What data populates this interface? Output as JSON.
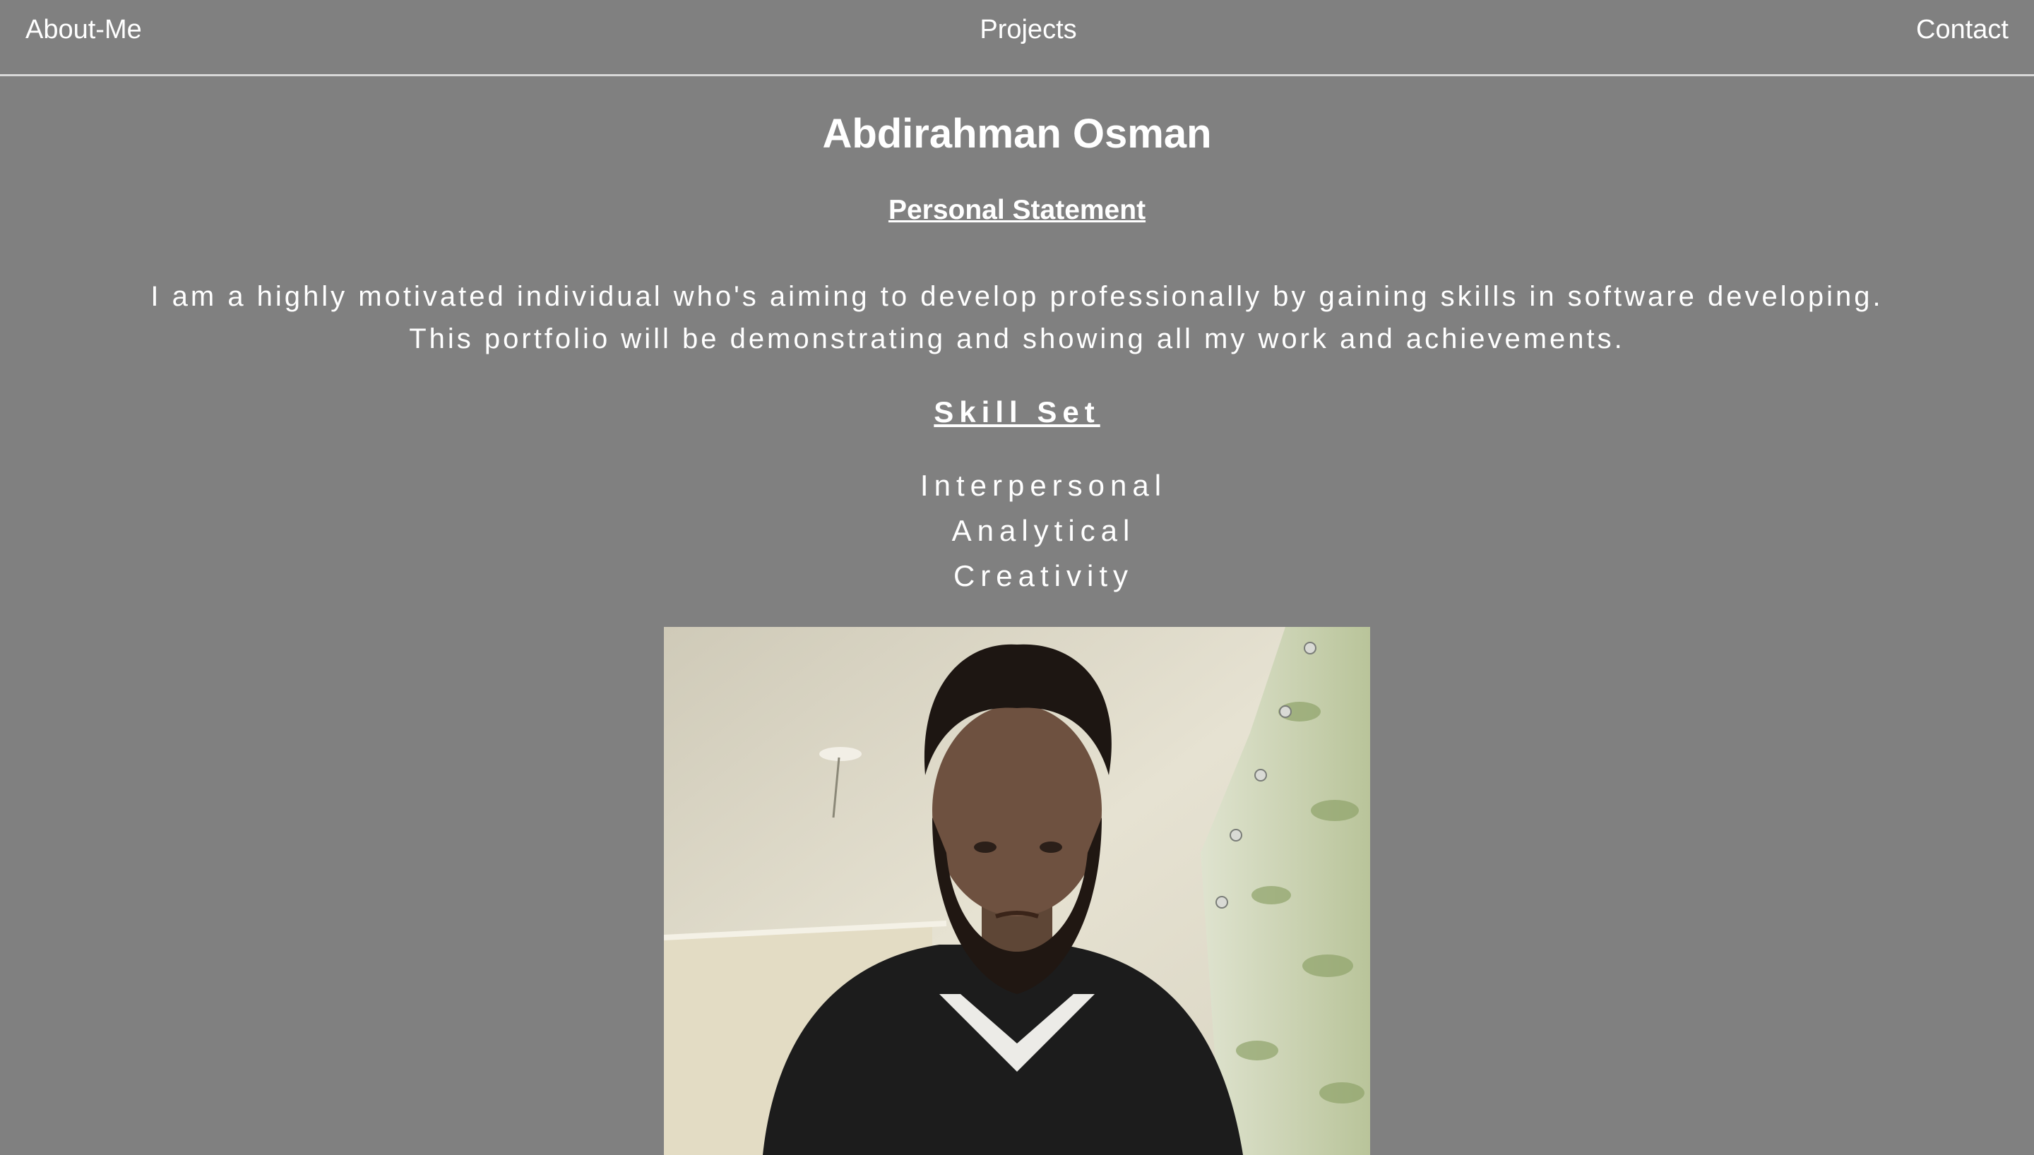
{
  "nav": {
    "about_label": "About-Me",
    "projects_label": "Projects",
    "contact_label": "Contact"
  },
  "profile": {
    "name": "Abdirahman Osman",
    "statement_heading": "Personal Statement",
    "statement": "I am a highly motivated individual who's aiming to develop professionally by gaining skills in software developing. This portfolio will be demonstrating and showing all my work and achievements.",
    "skills_heading": "Skill Set",
    "skills": [
      "Interpersonal",
      "Analytical",
      "Creativity"
    ]
  },
  "colors": {
    "background": "#808080",
    "text": "#ffffff",
    "nav_border": "#d9d9d9"
  }
}
